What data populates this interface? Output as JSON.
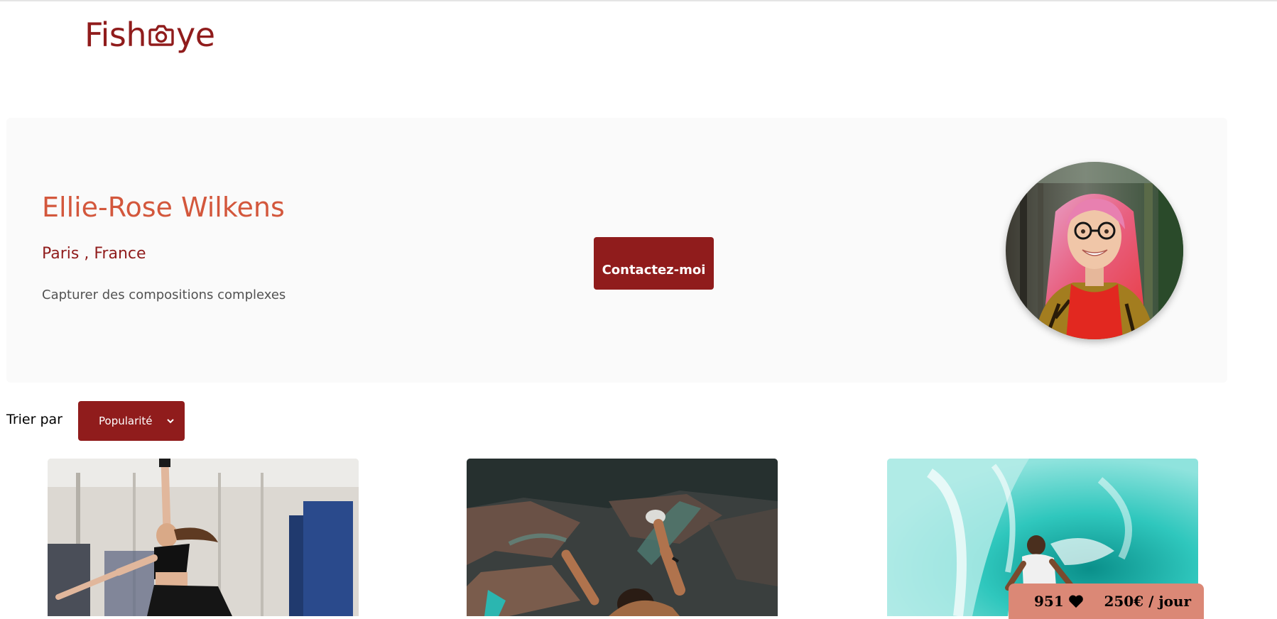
{
  "logo": {
    "text_before": "Fish",
    "text_after": "ye",
    "icon": "camera-icon",
    "color": "#901c1c"
  },
  "photographer": {
    "name": "Ellie-Rose Wilkens",
    "location": "Paris , France",
    "tagline": "Capturer des compositions complexes",
    "contact_label": "Contactez-moi",
    "portrait": "portrait-photo"
  },
  "sort": {
    "label": "Trier par",
    "selected": "Popularité",
    "icon": "chevron-down-icon"
  },
  "gallery": [
    {
      "alt": "gymnast-photo"
    },
    {
      "alt": "climber-photo"
    },
    {
      "alt": "surfer-photo"
    }
  ],
  "stats": {
    "likes": "951",
    "price": "250€ / jour",
    "icon": "heart-icon"
  },
  "colors": {
    "primary": "#901c1c",
    "accent": "#d3573c",
    "stat_bg": "#db8876",
    "card_bg": "#fafafa"
  }
}
